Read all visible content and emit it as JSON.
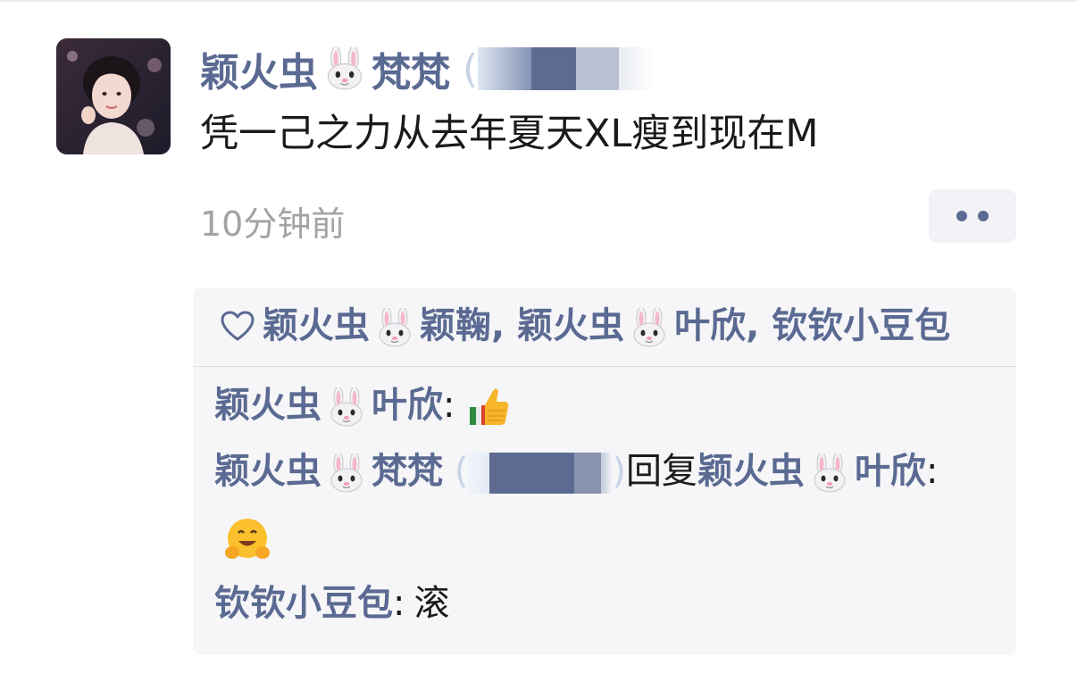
{
  "post": {
    "author_part1": "颖火虫",
    "author_part2": "梵梵",
    "author_paren_open": "(",
    "content": "凭一己之力从去年夏天XL瘦到现在M",
    "time": "10分钟前"
  },
  "likes": {
    "seg1": "颖火虫",
    "seg2": "颖鞠, 颖火虫",
    "seg3": "叶欣, 钦钦小豆包"
  },
  "comments": [
    {
      "name1": "颖火虫",
      "name2": "叶欣",
      "sep": ":"
    },
    {
      "name1": "颖火虫",
      "name2": "梵梵",
      "paren_open": "(",
      "paren_close": ")",
      "reply_word": "回复",
      "reply_name1": "颖火虫",
      "reply_name2": "叶欣",
      "sep": ":"
    },
    {
      "name": "钦钦小豆包",
      "sep": ":",
      "text": "滚"
    }
  ],
  "colors": {
    "name": "#5b6a92",
    "text": "#1a1a1a",
    "time": "#a3a3a3",
    "comment_bg": "#f6f6f8"
  },
  "icons": [
    "rabbit-face-emoji",
    "heart-outline-icon",
    "thumbs-up-emoji",
    "hugging-face-emoji",
    "more-dots-icon"
  ]
}
